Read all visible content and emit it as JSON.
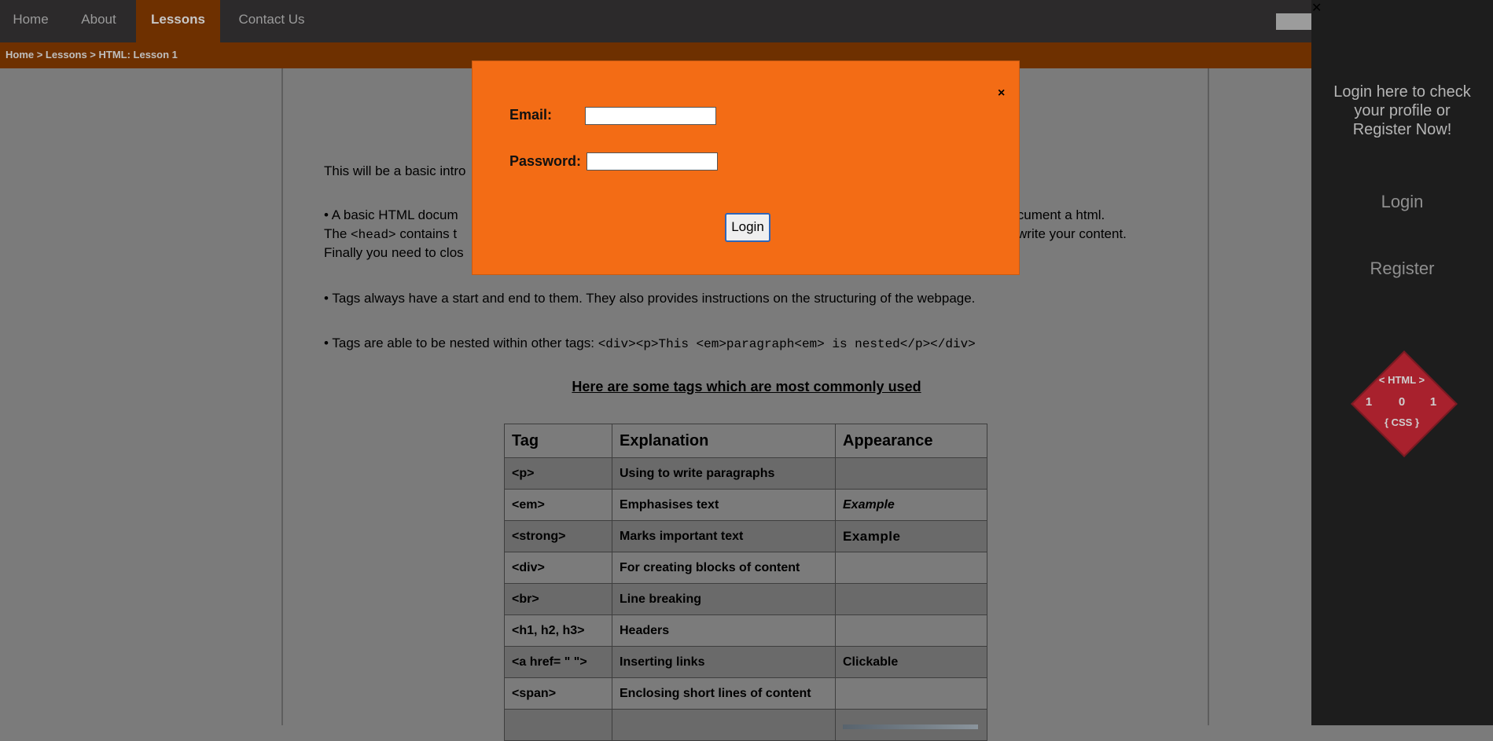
{
  "nav": {
    "items": [
      {
        "label": "Home"
      },
      {
        "label": "About"
      },
      {
        "label": "Lessons",
        "active": true
      },
      {
        "label": "Contact Us"
      }
    ]
  },
  "breadcrumb": "Home > Lessons > HTML: Lesson 1",
  "content": {
    "intro_start": "This will be a basic intro",
    "intro_end": ".",
    "bullet1_line1_start": "• A basic HTML docum",
    "bullet1_line1_end": "ur document a html.",
    "bullet1_line2_start": "The ",
    "bullet1_line2_code": "<head>",
    "bullet1_line2_mid": " contains t",
    "bullet1_line2_end": "write your content.",
    "bullet1_line3": "Finally you need to clos",
    "bullet2": "• Tags always have a start and end to them. They also provides instructions on the structuring of the webpage.",
    "bullet3_text": "• Tags are able to be nested within other tags: ",
    "bullet3_code": "<div><p>This <em>paragraph<em> is nested</p></div>",
    "table_heading": "Here are some tags which are most commonly used"
  },
  "table": {
    "headers": [
      "Tag",
      "Explanation",
      "Appearance"
    ],
    "rows": [
      {
        "tag": "<p>",
        "explanation": "Using to write paragraphs",
        "appearance": ""
      },
      {
        "tag": "<em>",
        "explanation": "Emphasises text",
        "appearance": "Example"
      },
      {
        "tag": "<strong>",
        "explanation": "Marks important text",
        "appearance": "Example"
      },
      {
        "tag": "<div>",
        "explanation": "For creating blocks of content",
        "appearance": ""
      },
      {
        "tag": "<br>",
        "explanation": "Line breaking",
        "appearance": ""
      },
      {
        "tag": "<h1, h2, h3>",
        "explanation": "Headers",
        "appearance": ""
      },
      {
        "tag": "<a href= \" \">",
        "explanation": "Inserting links",
        "appearance": "Clickable"
      },
      {
        "tag": "<span>",
        "explanation": "Enclosing short lines of content",
        "appearance": ""
      }
    ]
  },
  "modal": {
    "email_label": "Email:",
    "email_value": "",
    "password_label": "Password:",
    "password_value": "",
    "login_button": "Login",
    "close_glyph": "×"
  },
  "sidebar": {
    "close_glyph": "✕",
    "prompt_line1": "Login here to check",
    "prompt_line2": "your profile or",
    "prompt_line3": "Register Now!",
    "login_link": "Login",
    "register_link": "Register",
    "logo_line1": "< HTML >",
    "logo_line2a": "1",
    "logo_line2b": "0",
    "logo_line2c": "1",
    "logo_line3": "{ CSS }"
  },
  "colors": {
    "modal_bg": "#f36c15",
    "nav_bg": "#2c2a2b",
    "breadcrumb_bg": "#6e3000",
    "sidebar_bg": "#1d1d1d",
    "logo_red": "#a8212d"
  }
}
